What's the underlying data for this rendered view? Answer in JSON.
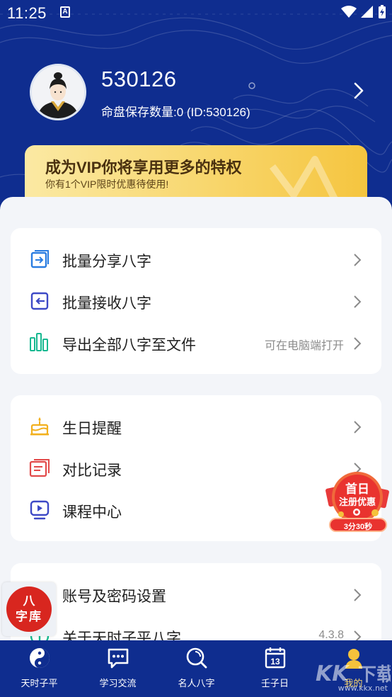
{
  "status_bar": {
    "time": "11:25",
    "notification_icon": "A"
  },
  "profile": {
    "user_id": "530126",
    "subtitle": "命盘保存数量:0 (ID:530126)"
  },
  "vip_banner": {
    "title": "成为VIP你将享用更多的特权",
    "subtitle": "你有1个VIP限时优惠待使用!"
  },
  "menu_group_1": [
    {
      "label": "批量分享八字",
      "hint": "",
      "icon": "share-icon"
    },
    {
      "label": "批量接收八字",
      "hint": "",
      "icon": "receive-icon"
    },
    {
      "label": "导出全部八字至文件",
      "hint": "可在电脑端打开",
      "icon": "export-chart-icon"
    }
  ],
  "menu_group_2": [
    {
      "label": "生日提醒",
      "hint": "",
      "icon": "birthday-cake-icon"
    },
    {
      "label": "对比记录",
      "hint": "",
      "icon": "compare-record-icon"
    },
    {
      "label": "课程中心",
      "hint": "",
      "icon": "video-play-icon"
    }
  ],
  "menu_group_3": [
    {
      "label": "账号及密码设置",
      "hint": "",
      "icon": "account-settings-icon"
    },
    {
      "label": "关于天时子平八字",
      "hint": "4.3.8",
      "icon": "info-icon"
    }
  ],
  "promo_badge": {
    "line1": "首日",
    "line2": "注册优惠",
    "timer": "3分30秒"
  },
  "bazi_fab": {
    "line1": "八",
    "line2": "字库"
  },
  "bottom_nav": [
    {
      "label": "天时子平",
      "icon": "yin-yang-icon",
      "active": false
    },
    {
      "label": "学习交流",
      "icon": "chat-icon",
      "active": false
    },
    {
      "label": "名人八字",
      "icon": "search-icon",
      "active": false
    },
    {
      "label": "壬子日",
      "icon": "calendar-icon",
      "active": false,
      "day": "13"
    },
    {
      "label": "我的",
      "icon": "profile-icon",
      "active": true
    }
  ],
  "watermark": "www.kkx.net",
  "colors": {
    "header_bg": "#0f2d8f",
    "vip_gold": "#f8d66c",
    "accent_blue": "#3d49c6",
    "accent_green": "#17b890",
    "accent_red": "#d8261f"
  }
}
